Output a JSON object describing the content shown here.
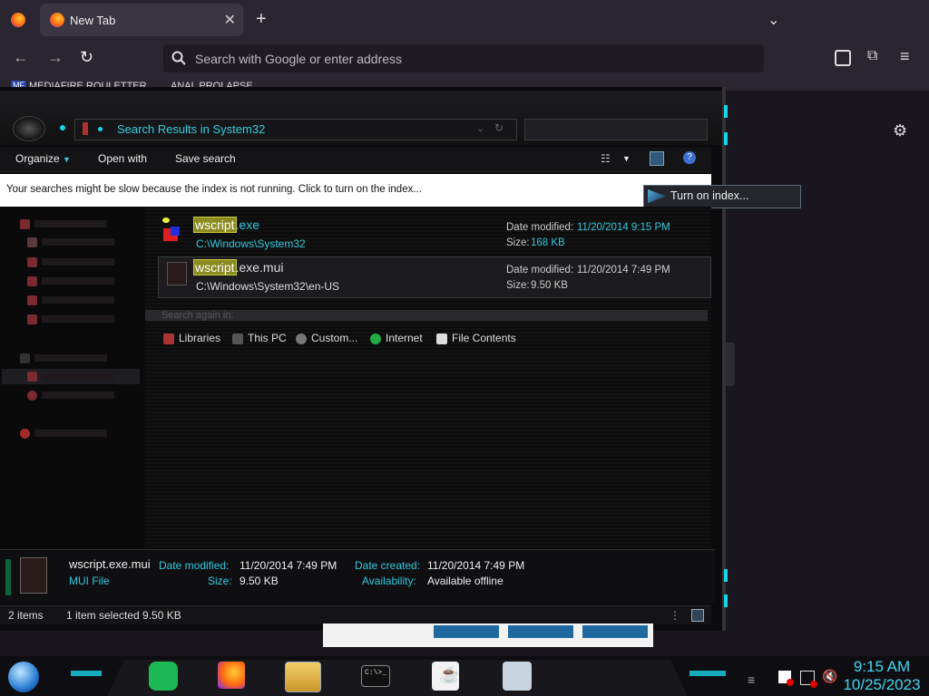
{
  "browser": {
    "tab_title": "New Tab",
    "tab_close": "✕",
    "new_tab": "+",
    "url_placeholder": "Search with Google or enter address",
    "bookmarks": [
      "MEDIAFIRE ROULETTER",
      "ANAL PROLAPSE"
    ],
    "bookmark_badge": "MF"
  },
  "explorer": {
    "address": "Search Results in System32",
    "toolbar": {
      "organize": "Organize",
      "open_with": "Open with",
      "save_search": "Save search"
    },
    "infobar": {
      "message": "Your searches might be slow because the index is not running.  Click to turn on the index...",
      "button": "Turn on index..."
    },
    "results": [
      {
        "name_highlight": "wscript",
        "name_rest": ".exe",
        "path": "C:\\Windows\\System32",
        "date_label": "Date modified:",
        "date": "11/20/2014 9:15 PM",
        "size_label": "Size:",
        "size": "168 KB"
      },
      {
        "name_highlight": "wscript",
        "name_rest": ".exe.mui",
        "path": "C:\\Windows\\System32\\en-US",
        "date_label": "Date modified:",
        "date": "11/20/2014 7:49 PM",
        "size_label": "Size:",
        "size": "9.50 KB"
      }
    ],
    "search_again": {
      "label": "Search again in:",
      "locations": [
        "Libraries",
        "This PC",
        "Custom...",
        "Internet",
        "File Contents"
      ]
    },
    "details": {
      "filename": "wscript.exe.mui",
      "filetype": "MUI File",
      "date_modified_label": "Date modified:",
      "date_modified": "11/20/2014 7:49 PM",
      "size_label": "Size:",
      "size": "9.50 KB",
      "date_created_label": "Date created:",
      "date_created": "11/20/2014 7:49 PM",
      "availability_label": "Availability:",
      "availability": "Available offline"
    },
    "status": {
      "items": "2 items",
      "selected": "1 item selected  9.50 KB"
    }
  },
  "taskbar": {
    "time": "9:15 AM",
    "date": "10/25/2023",
    "cmd_label": "C:\\>_"
  },
  "colors": {
    "accent_cyan": "#33c8dd",
    "highlight": "#8b8b22"
  }
}
